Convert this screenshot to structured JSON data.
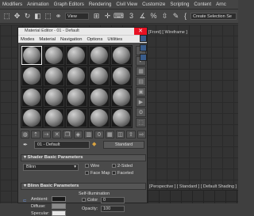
{
  "menubar": {
    "items": [
      "Modifiers",
      "Animation",
      "Graph Editors",
      "Rendering",
      "Civil View",
      "Customize",
      "Scripting",
      "Content",
      "Arnc"
    ]
  },
  "toolbar": {
    "view_dropdown": "View",
    "selection_set": "Create Selection Se"
  },
  "viewports": {
    "top_label": "[Front] [ Wireframe ]",
    "perspective_label": "[Perspective ] [ Standard ] [ Default Shading ]"
  },
  "material_editor": {
    "title": "Material Editor - 01 - Default",
    "menu": [
      "Modes",
      "Material",
      "Navigation",
      "Options",
      "Utilities"
    ],
    "material_name": "01 - Default",
    "material_type": "Standard",
    "shader_rollout": {
      "title": "Shader Basic Parameters",
      "shader": "Blinn",
      "wire": "Wire",
      "two_sided": "2-Sided",
      "face_map": "Face Map",
      "faceted": "Faceted"
    },
    "blinn_rollout": {
      "title": "Blinn Basic Parameters",
      "self_illumination": "Self-Illumination",
      "color_label": "Color",
      "color_value": "0",
      "ambient": "Ambient:",
      "diffuse": "Diffuse:",
      "specular": "Specular:",
      "opacity_label": "Opacity:",
      "opacity_value": "100"
    }
  },
  "colors": {
    "accent": "#3a5c8a",
    "close": "#e81123"
  }
}
